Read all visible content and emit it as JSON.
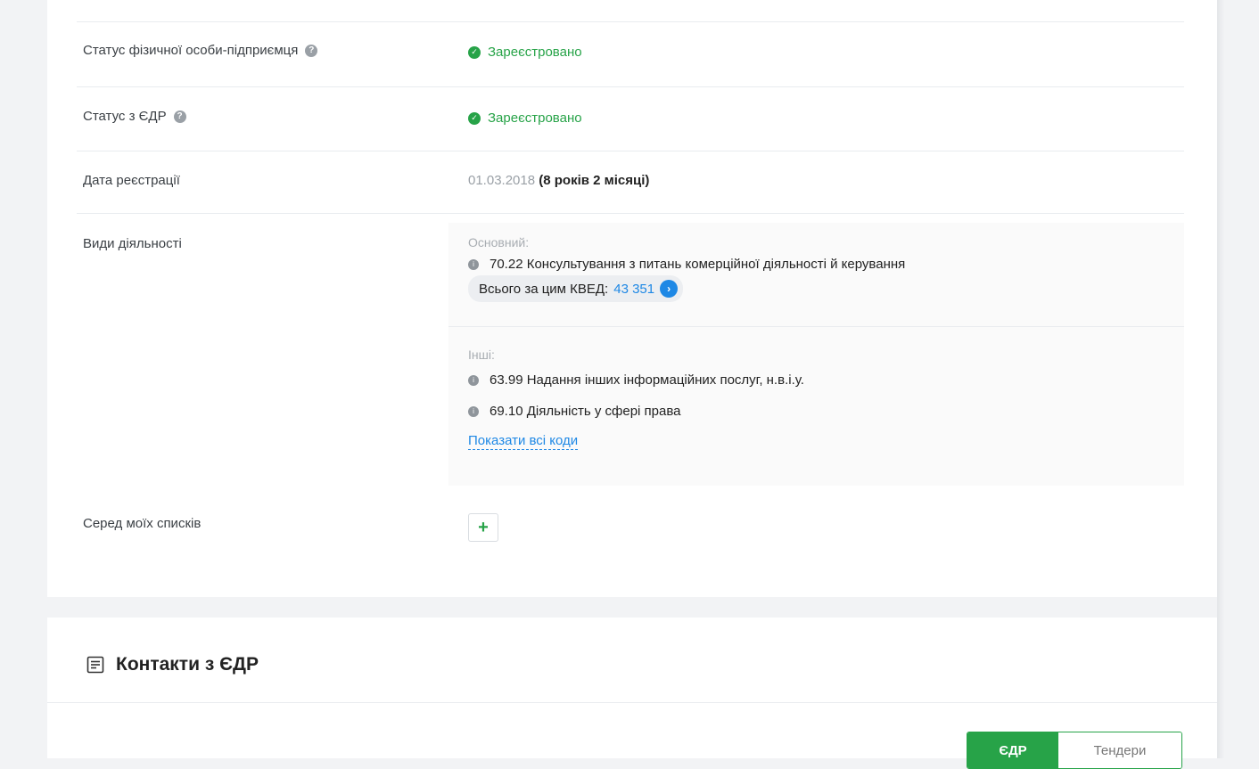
{
  "details": {
    "rows": {
      "fop_status": {
        "label": "Статус фізичної особи-підприємця",
        "help_icon": "question-icon",
        "value": "Зареєстровано",
        "value_icon": "check-circle-icon"
      },
      "edr_status": {
        "label": "Статус з ЄДР",
        "help_icon": "question-icon",
        "value": "Зареєстровано",
        "value_icon": "check-circle-icon"
      },
      "registration_date": {
        "label": "Дата реєстрації",
        "date": "01.03.2018",
        "duration": "(8 років 2 місяці)"
      },
      "activities": {
        "label": "Види діяльності",
        "primary_heading": "Основний:",
        "primary": {
          "code_text": "70.22 Консультування з питань комерційної діяльності й керування",
          "total_label": "Всього за цим КВЕД:",
          "total_value": "43 351"
        },
        "others_heading": "Інші:",
        "others": [
          "63.99 Надання інших інформаційних послуг, н.в.і.у.",
          "69.10 Діяльність у сфері права"
        ],
        "show_all": "Показати всі коди"
      },
      "lists": {
        "label": "Серед моїх списків",
        "add_symbol": "+"
      }
    },
    "colors": {
      "success": "#27a348",
      "link": "#1e88e5",
      "muted": "#9aa0a6"
    }
  },
  "contacts": {
    "title": "Контакти з ЄДР",
    "icon": "document-list-icon",
    "tabs": [
      "ЄДР",
      "Тендери"
    ],
    "active_tab": "ЄДР"
  }
}
